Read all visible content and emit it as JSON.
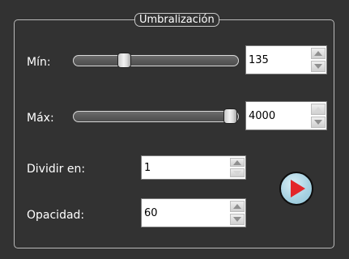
{
  "group": {
    "title": "Umbralización"
  },
  "min": {
    "label": "Mín:",
    "value": "135",
    "slider_fraction": 0.3
  },
  "max": {
    "label": "Máx:",
    "value": "4000",
    "slider_fraction": 1.0
  },
  "divide": {
    "label": "Dividir en:",
    "value": "1"
  },
  "opacity": {
    "label": "Opacidad:",
    "value": "60"
  },
  "actions": {
    "run_icon": "play-icon"
  },
  "colors": {
    "background": "#323232",
    "frame_border": "#b9b9b9",
    "play_fill": "#a9d3e3",
    "play_arrow": "#e3262a"
  }
}
